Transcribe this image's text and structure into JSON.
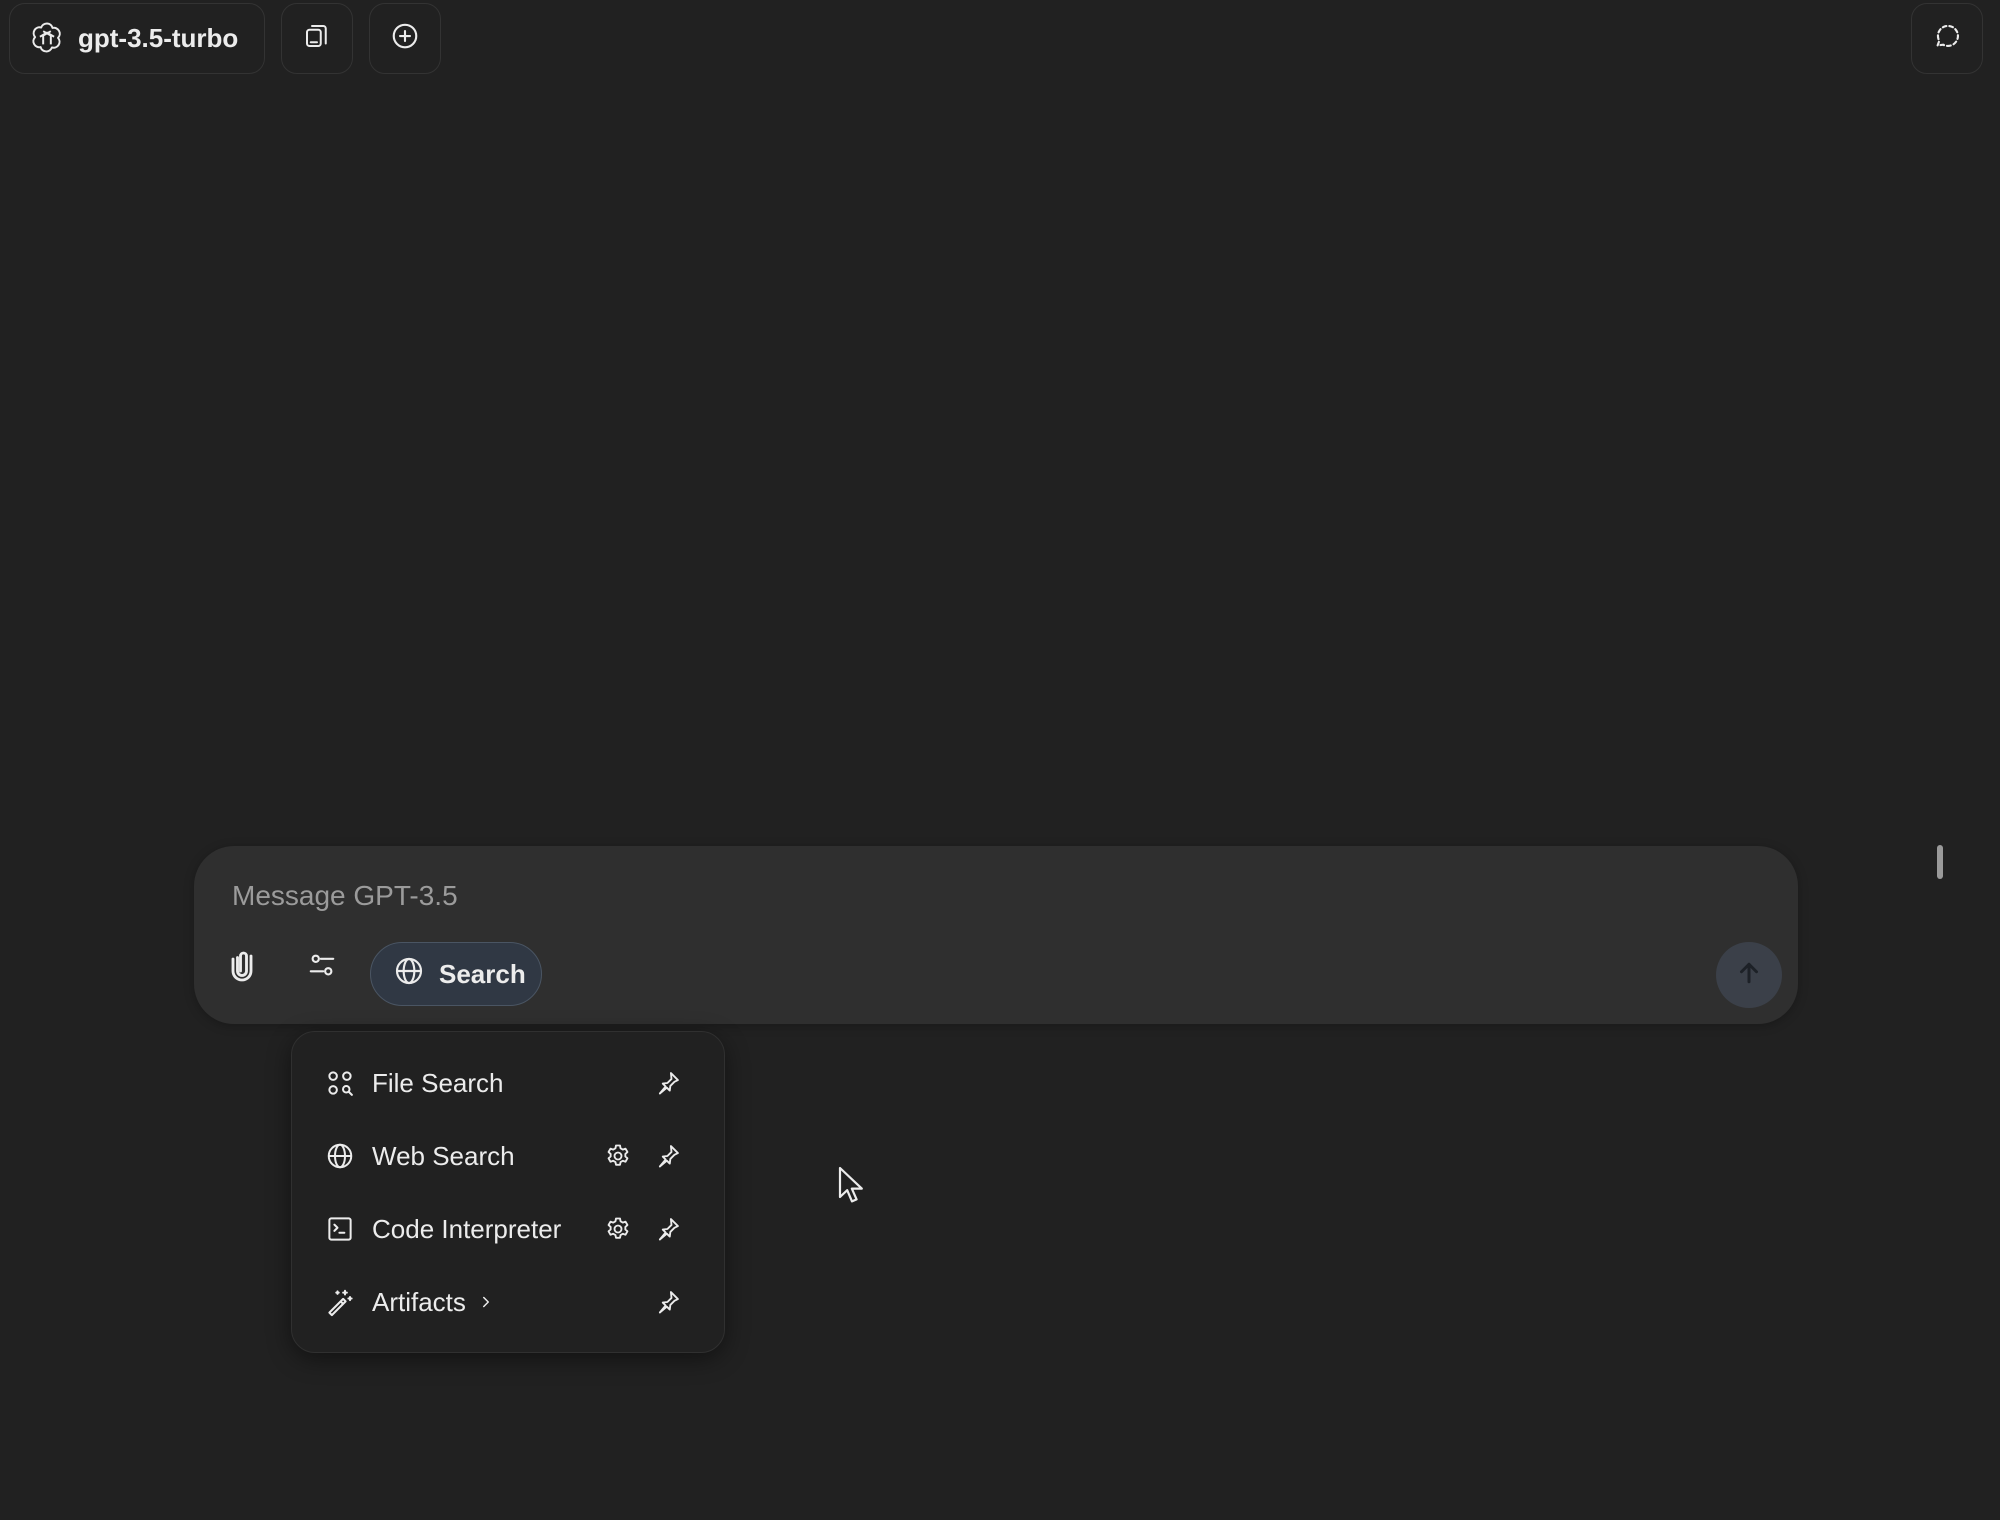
{
  "header": {
    "model_label": "gpt-3.5-turbo"
  },
  "composer": {
    "placeholder": "Message GPT-3.5",
    "search_label": "Search"
  },
  "tools_menu": {
    "items": [
      {
        "label": "File Search",
        "icon": "file-search-icon",
        "has_settings": false,
        "has_submenu": false
      },
      {
        "label": "Web Search",
        "icon": "globe-icon",
        "has_settings": true,
        "has_submenu": false
      },
      {
        "label": "Code Interpreter",
        "icon": "terminal-icon",
        "has_settings": true,
        "has_submenu": false
      },
      {
        "label": "Artifacts",
        "icon": "magic-wand-icon",
        "has_settings": false,
        "has_submenu": true
      }
    ]
  },
  "colors": {
    "background": "#212121",
    "composer": "#2f2f2f",
    "search_pill": "#303844",
    "search_pill_border": "#4a5563",
    "text": "#ececec",
    "placeholder": "#9b9b9b"
  }
}
